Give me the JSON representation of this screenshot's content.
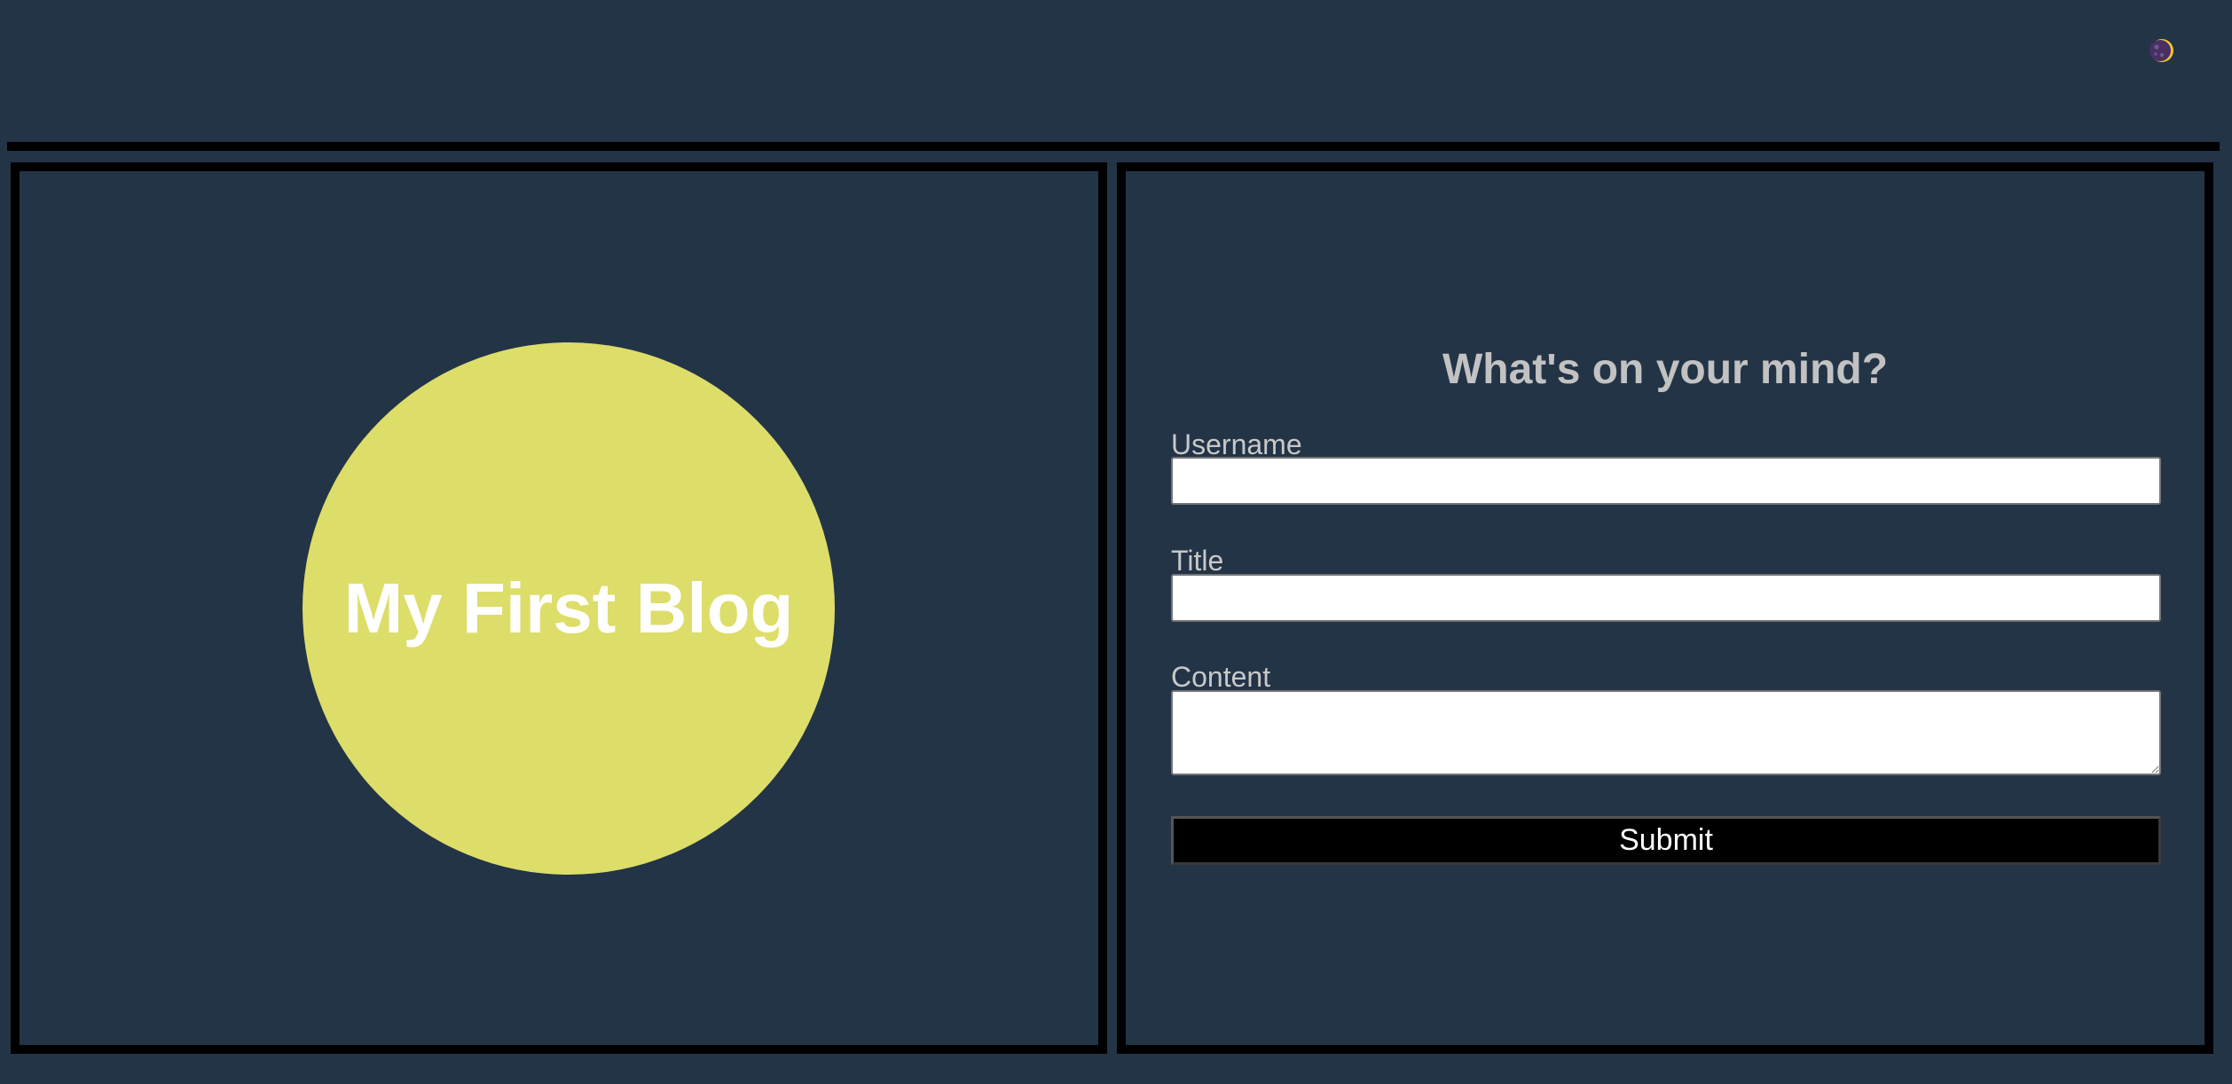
{
  "header": {
    "theme_toggle_icon": "moon-icon"
  },
  "hero": {
    "title": "My First Blog",
    "circle_color": "#dddd6a"
  },
  "form": {
    "heading": "What's on your mind?",
    "fields": [
      {
        "label": "Username",
        "value": "",
        "placeholder": ""
      },
      {
        "label": "Title",
        "value": "",
        "placeholder": ""
      },
      {
        "label": "Content",
        "value": "",
        "placeholder": ""
      }
    ],
    "submit_label": "Submit"
  },
  "colors": {
    "background": "#233447",
    "border": "#000000",
    "accent": "#dddd6a"
  }
}
